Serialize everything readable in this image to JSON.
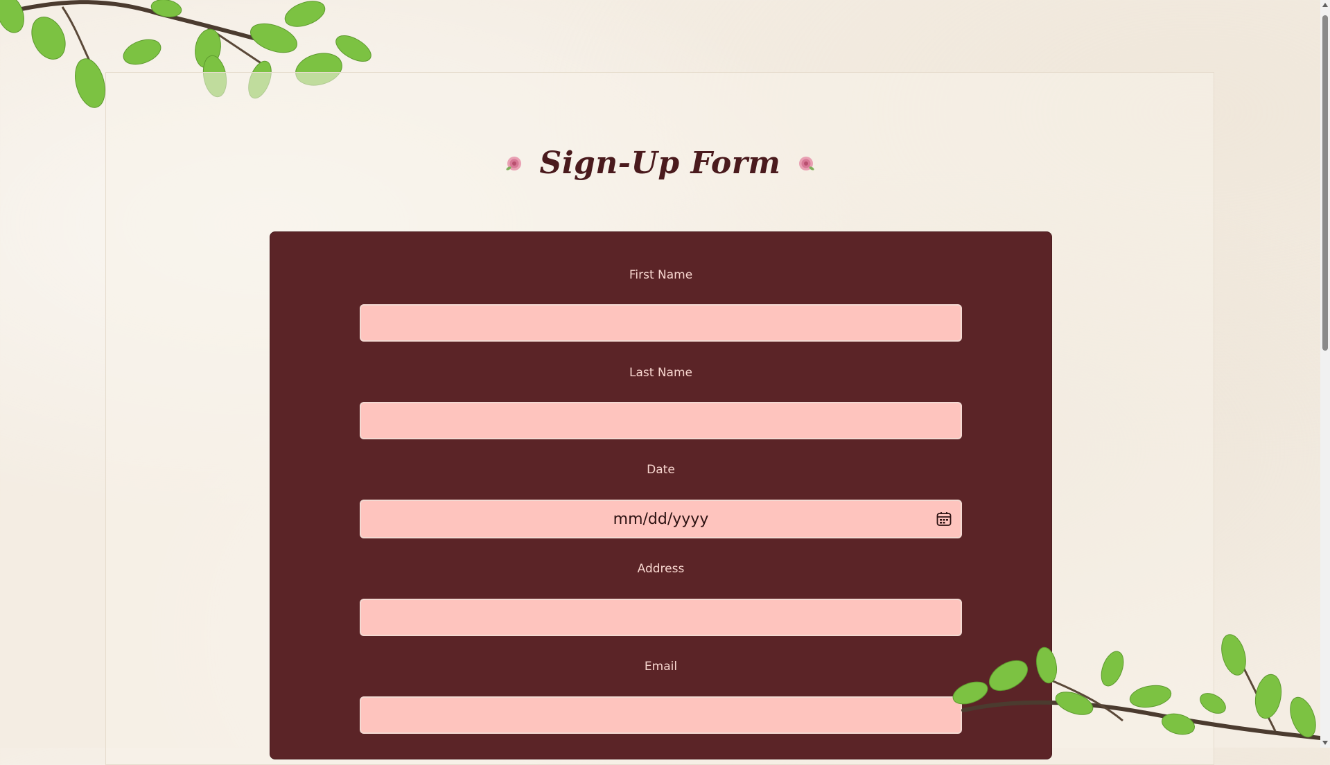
{
  "page": {
    "title": "Sign-Up Form",
    "title_icon": "rose-icon"
  },
  "form": {
    "fields": [
      {
        "label": "First Name",
        "value": "",
        "placeholder": ""
      },
      {
        "label": "Last Name",
        "value": "",
        "placeholder": ""
      },
      {
        "label": "Date",
        "value": "",
        "placeholder": "mm/dd/yyyy"
      },
      {
        "label": "Address",
        "value": "",
        "placeholder": ""
      },
      {
        "label": "Email",
        "value": "",
        "placeholder": ""
      }
    ]
  },
  "colors": {
    "background": "#f4ede3",
    "panel": "#5b2427",
    "input": "#fec4be",
    "label": "#f7d6cf",
    "title": "#4a1a1d",
    "leaf": "#7cc242"
  }
}
